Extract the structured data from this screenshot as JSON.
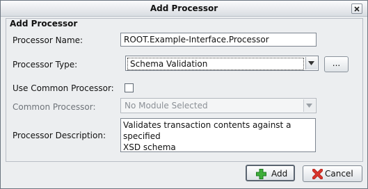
{
  "window": {
    "title": "Add Processor"
  },
  "group": {
    "title": "Add Processor"
  },
  "fields": {
    "name_label": "Processor Name:",
    "name_value": "ROOT.Example-Interface.Processor",
    "type_label": "Processor Type:",
    "type_value": "Schema Validation",
    "browse_label": "...",
    "use_common_label": "Use Common Processor:",
    "use_common_checked": false,
    "common_label": "Common Processor:",
    "common_value": "No Module Selected",
    "description_label": "Processor Description:",
    "description_value": "Validates transaction contents against a specified\nXSD schema"
  },
  "buttons": {
    "add_label": "Add",
    "cancel_label": "Cancel"
  },
  "icons": {
    "close": "close-icon",
    "dropdown": "chevron-down-icon",
    "add": "plus-icon",
    "cancel": "x-icon"
  },
  "colors": {
    "add_icon": "#3fae3a",
    "cancel_icon": "#d9342b"
  }
}
